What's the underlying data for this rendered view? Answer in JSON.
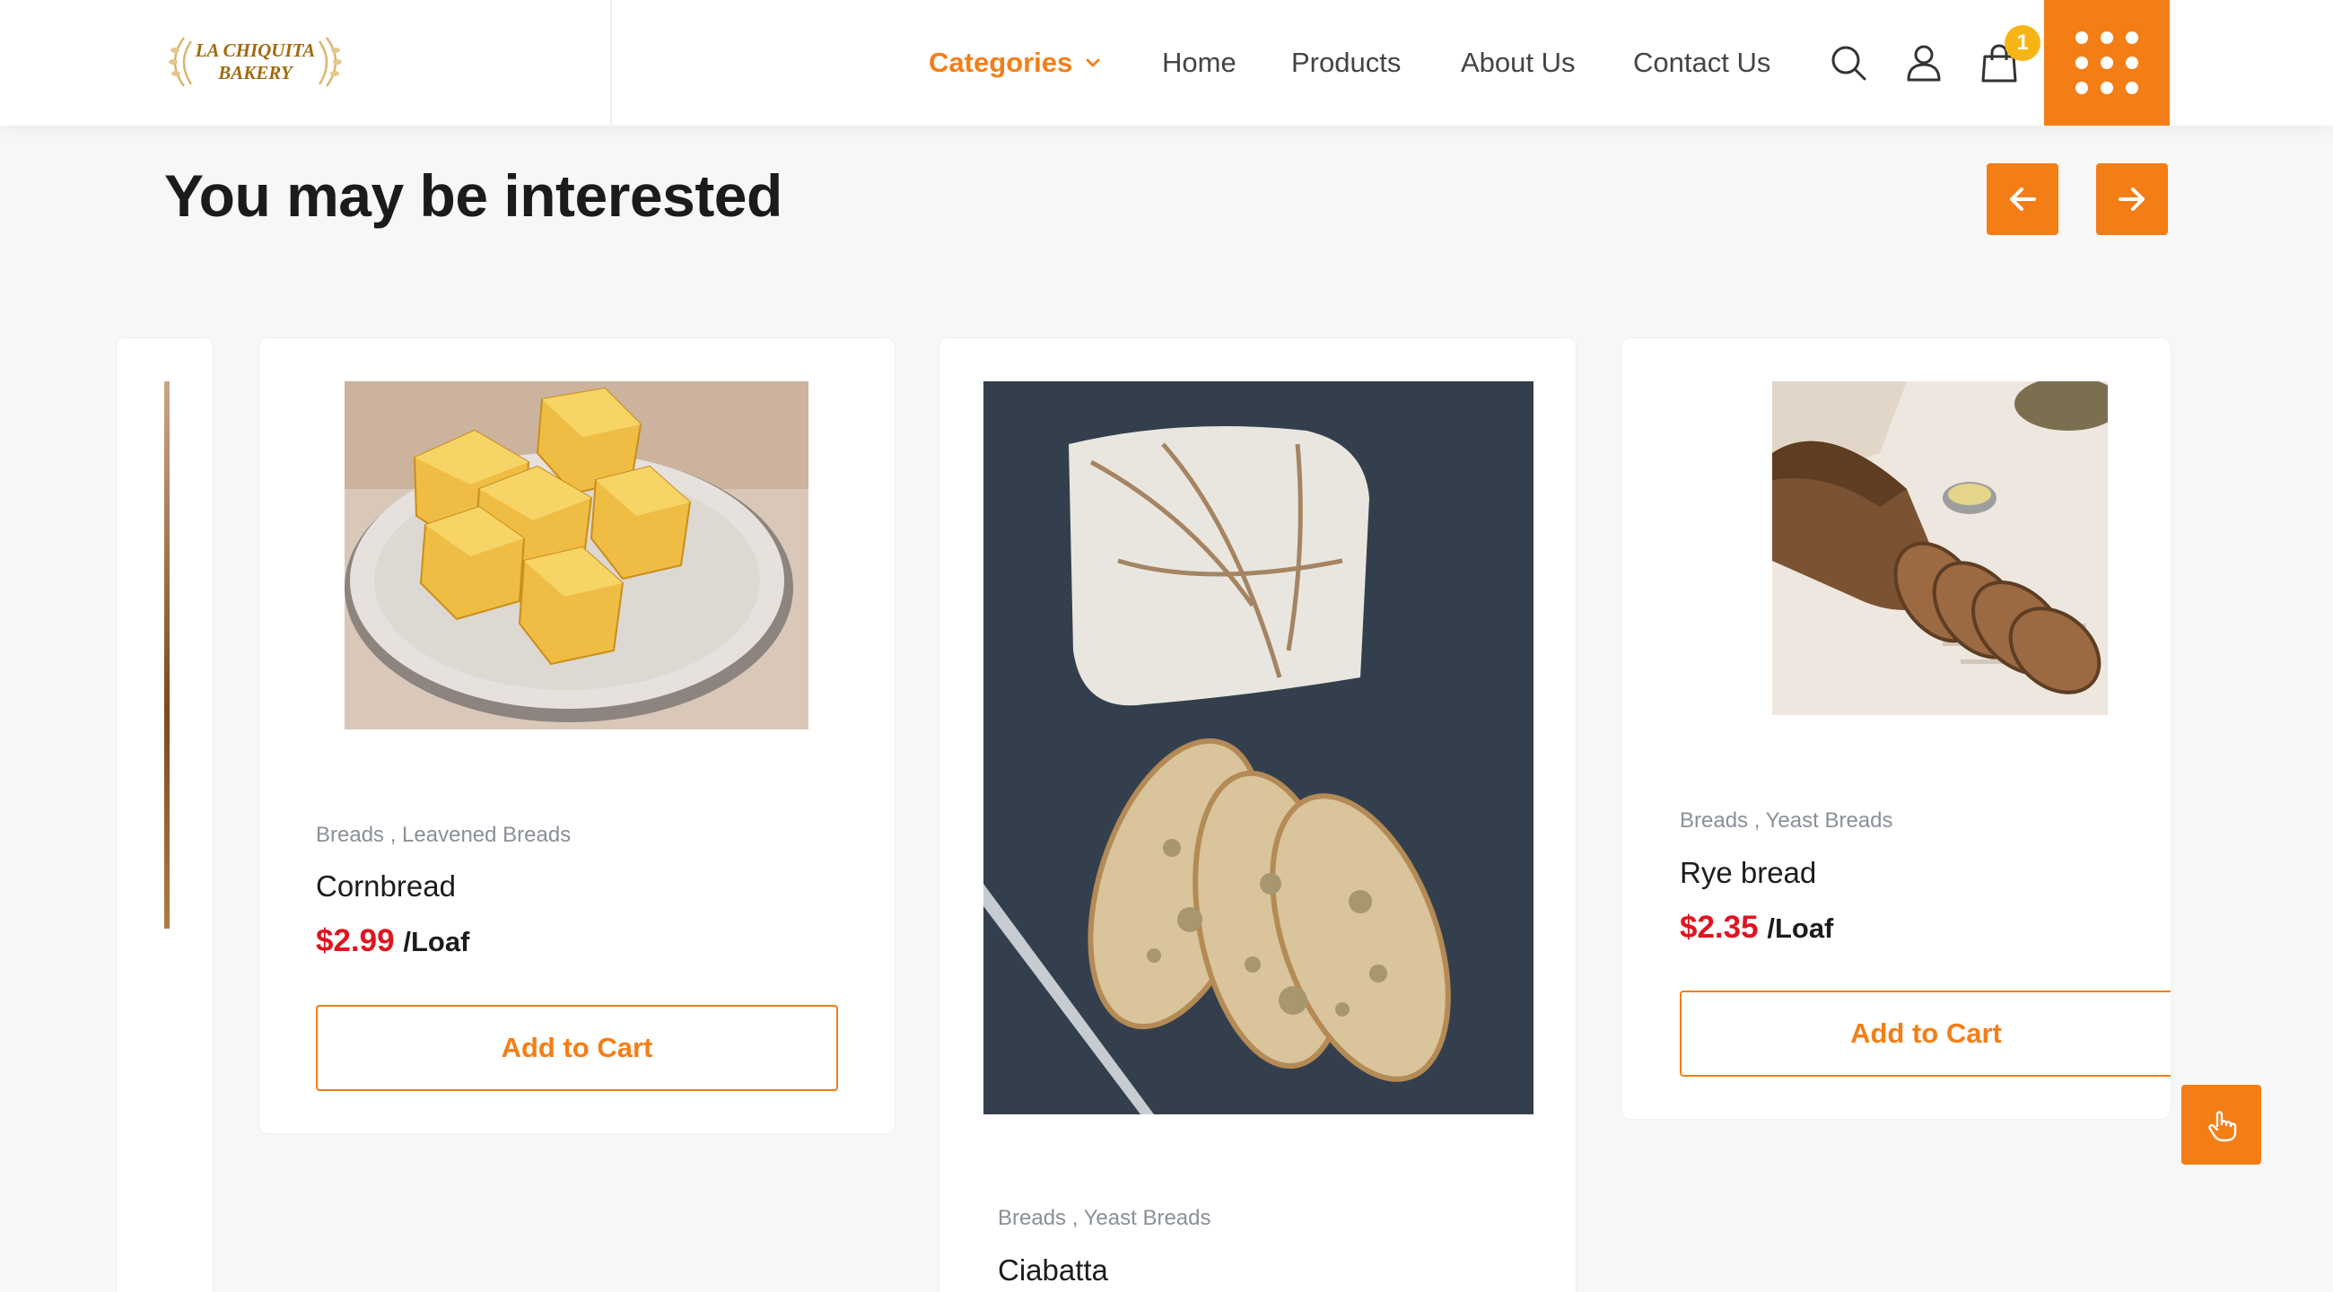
{
  "brand": {
    "logo_line1": "LA CHIQUITA",
    "logo_line2": "BAKERY",
    "accent_color": "#f47e16",
    "price_color": "#e0141f",
    "badge_color": "#f7b515"
  },
  "nav": {
    "categories_label": "Categories",
    "home_label": "Home",
    "products_label": "Products",
    "about_label": "About Us",
    "contact_label": "Contact Us",
    "cart_count": "1",
    "icons": [
      "search-icon",
      "user-icon",
      "shopping-bag-icon",
      "grid-menu-icon"
    ]
  },
  "section": {
    "title": "You may be interested"
  },
  "products": [
    {
      "categories": "Breads , Leavened Breads",
      "name": "Cornbread",
      "price": "$2.99",
      "unit": "/Loaf",
      "button": "Add to Cart"
    },
    {
      "categories": "Breads , Yeast Breads",
      "name": "Ciabatta"
    },
    {
      "categories": "Breads , Yeast Breads",
      "name": "Rye bread",
      "price": "$2.35",
      "unit": "/Loaf",
      "button": "Add to Cart"
    }
  ]
}
